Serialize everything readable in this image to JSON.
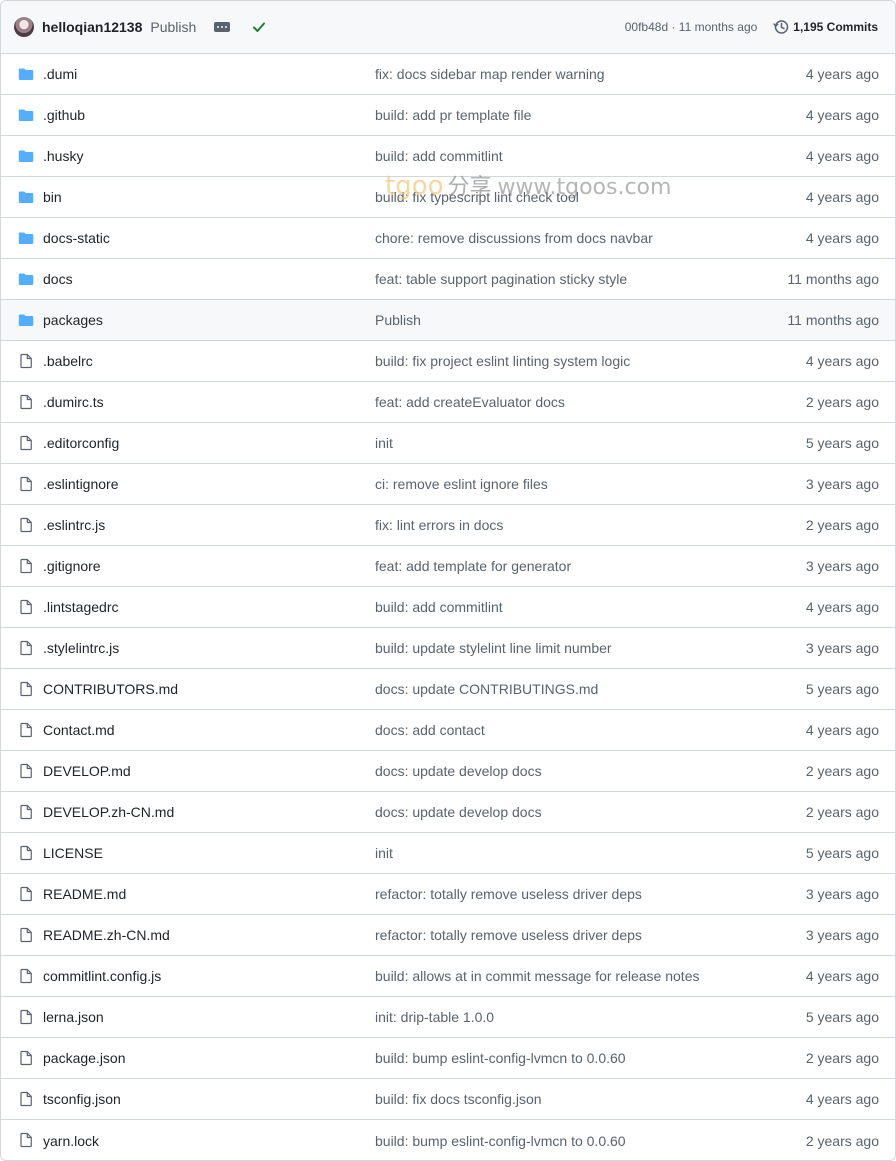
{
  "header": {
    "author": "helloqian12138",
    "message": "Publish",
    "sha": "00fb48d · 11 months ago",
    "commits": "1,195 Commits",
    "status": "success"
  },
  "watermark": {
    "brand": "tgoo",
    "cn": "分享",
    "url": "www.tgoos.com"
  },
  "colors": {
    "folder": "#54aeff",
    "success": "#1a7f37",
    "muted": "#59636e",
    "border": "#d0d7de"
  },
  "files": [
    {
      "name": ".dumi",
      "type": "folder",
      "message": "fix: docs sidebar map render warning",
      "date": "4 years ago"
    },
    {
      "name": ".github",
      "type": "folder",
      "message": "build: add pr template file",
      "date": "4 years ago"
    },
    {
      "name": ".husky",
      "type": "folder",
      "message": "build: add commitlint",
      "date": "4 years ago"
    },
    {
      "name": "bin",
      "type": "folder",
      "message": "build: fix typescript lint check tool",
      "date": "4 years ago"
    },
    {
      "name": "docs-static",
      "type": "folder",
      "message": "chore: remove discussions from docs navbar",
      "date": "4 years ago"
    },
    {
      "name": "docs",
      "type": "folder",
      "message": "feat: table support pagination sticky style",
      "date": "11 months ago"
    },
    {
      "name": "packages",
      "type": "folder",
      "message": "Publish",
      "date": "11 months ago"
    },
    {
      "name": ".babelrc",
      "type": "file",
      "message": "build: fix project eslint linting system logic",
      "date": "4 years ago"
    },
    {
      "name": ".dumirc.ts",
      "type": "file",
      "message": "feat: add createEvaluator docs",
      "date": "2 years ago"
    },
    {
      "name": ".editorconfig",
      "type": "file",
      "message": "init",
      "date": "5 years ago"
    },
    {
      "name": ".eslintignore",
      "type": "file",
      "message": "ci: remove eslint ignore files",
      "date": "3 years ago"
    },
    {
      "name": ".eslintrc.js",
      "type": "file",
      "message": "fix: lint errors in docs",
      "date": "2 years ago"
    },
    {
      "name": ".gitignore",
      "type": "file",
      "message": "feat: add template for generator",
      "date": "3 years ago"
    },
    {
      "name": ".lintstagedrc",
      "type": "file",
      "message": "build: add commitlint",
      "date": "4 years ago"
    },
    {
      "name": ".stylelintrc.js",
      "type": "file",
      "message": "build: update stylelint line limit number",
      "date": "3 years ago"
    },
    {
      "name": "CONTRIBUTORS.md",
      "type": "file",
      "message": "docs: update CONTRIBUTINGS.md",
      "date": "5 years ago"
    },
    {
      "name": "Contact.md",
      "type": "file",
      "message": "docs: add contact",
      "date": "4 years ago"
    },
    {
      "name": "DEVELOP.md",
      "type": "file",
      "message": "docs: update develop docs",
      "date": "2 years ago"
    },
    {
      "name": "DEVELOP.zh-CN.md",
      "type": "file",
      "message": "docs: update develop docs",
      "date": "2 years ago"
    },
    {
      "name": "LICENSE",
      "type": "file",
      "message": "init",
      "date": "5 years ago"
    },
    {
      "name": "README.md",
      "type": "file",
      "message": "refactor: totally remove useless driver deps",
      "date": "3 years ago"
    },
    {
      "name": "README.zh-CN.md",
      "type": "file",
      "message": "refactor: totally remove useless driver deps",
      "date": "3 years ago"
    },
    {
      "name": "commitlint.config.js",
      "type": "file",
      "message": "build: allows at in commit message for release notes",
      "date": "4 years ago"
    },
    {
      "name": "lerna.json",
      "type": "file",
      "message": "init: drip-table 1.0.0",
      "date": "5 years ago"
    },
    {
      "name": "package.json",
      "type": "file",
      "message": "build: bump eslint-config-lvmcn to 0.0.60",
      "date": "2 years ago"
    },
    {
      "name": "tsconfig.json",
      "type": "file",
      "message": "build: fix docs tsconfig.json",
      "date": "4 years ago"
    },
    {
      "name": "yarn.lock",
      "type": "file",
      "message": "build: bump eslint-config-lvmcn to 0.0.60",
      "date": "2 years ago"
    }
  ]
}
